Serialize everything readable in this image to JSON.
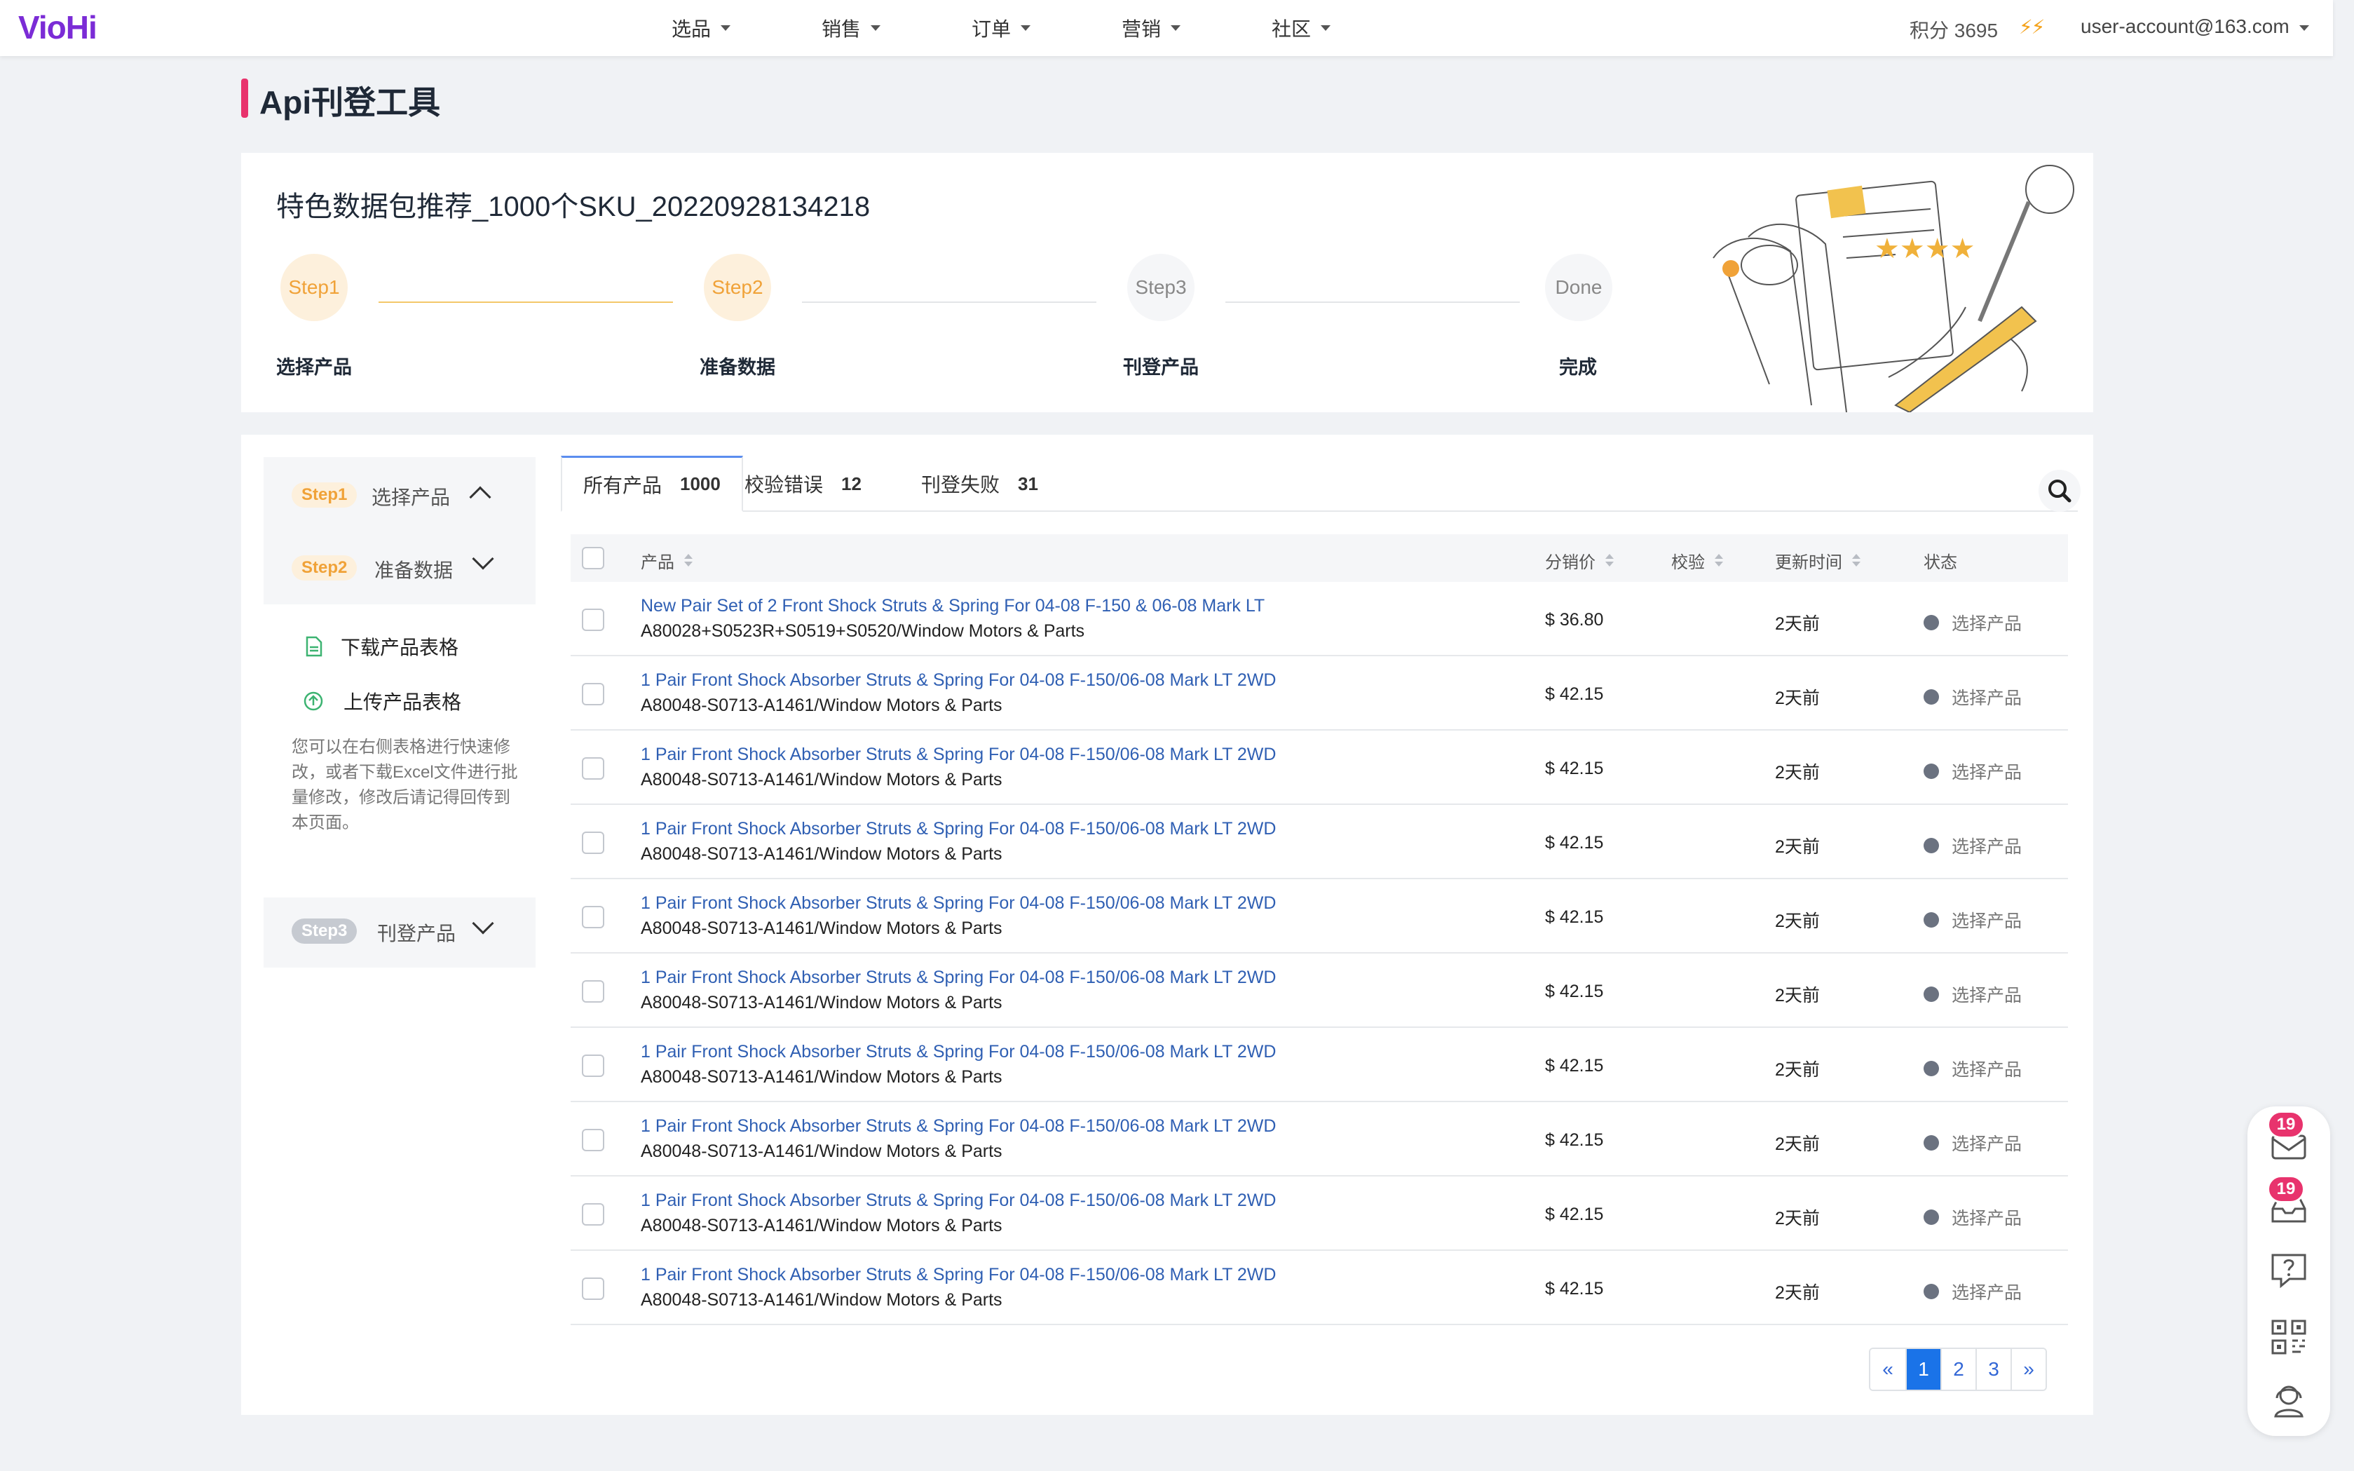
{
  "app": {
    "logo": "VioHi",
    "nav": [
      "选品",
      "销售",
      "订单",
      "营销",
      "社区"
    ],
    "points_label": "积分 3695",
    "bolts": "⚡⚡",
    "account": "user-account@163.com"
  },
  "page": {
    "title": "Api刊登工具"
  },
  "header": {
    "pack_title": "特色数据包推荐_1000个SKU_20220928134218",
    "steps": [
      {
        "circle": "Step1",
        "label": "选择产品"
      },
      {
        "circle": "Step2",
        "label": "准备数据"
      },
      {
        "circle": "Step3",
        "label": "刊登产品"
      },
      {
        "circle": "Done",
        "label": "完成"
      }
    ]
  },
  "left_panel": {
    "step1": {
      "tag": "Step1",
      "label": "选择产品"
    },
    "step2": {
      "tag": "Step2",
      "label": "准备数据"
    },
    "download": "下载产品表格",
    "upload": "上传产品表格",
    "note": "您可以在右侧表格进行快速修改，或者下载Excel文件进行批量修改，修改后请记得回传到本页面。",
    "step3": {
      "tag": "Step3",
      "label": "刊登产品"
    }
  },
  "tabs": [
    {
      "label": "所有产品",
      "count": "1000"
    },
    {
      "label": "校验错误",
      "count": "12"
    },
    {
      "label": "刊登失败",
      "count": "31"
    }
  ],
  "table": {
    "columns": {
      "product": "产品",
      "price": "分销价",
      "check": "校验",
      "updated": "更新时间",
      "status": "状态"
    },
    "rows": [
      {
        "name": "New Pair Set of 2 Front Shock Struts & Spring For 04-08 F-150 & 06-08 Mark LT",
        "sku": "A80028+S0523R+S0519+S0520/Window Motors & Parts",
        "price": "$ 36.80",
        "updated": "2天前",
        "status": "选择产品"
      },
      {
        "name": "1 Pair Front Shock Absorber Struts & Spring For 04-08 F-150/06-08 Mark LT 2WD",
        "sku": "A80048-S0713-A1461/Window Motors & Parts",
        "price": "$ 42.15",
        "updated": "2天前",
        "status": "选择产品"
      },
      {
        "name": "1 Pair Front Shock Absorber Struts & Spring For 04-08 F-150/06-08 Mark LT 2WD",
        "sku": "A80048-S0713-A1461/Window Motors & Parts",
        "price": "$ 42.15",
        "updated": "2天前",
        "status": "选择产品"
      },
      {
        "name": "1 Pair Front Shock Absorber Struts & Spring For 04-08 F-150/06-08 Mark LT 2WD",
        "sku": "A80048-S0713-A1461/Window Motors & Parts",
        "price": "$ 42.15",
        "updated": "2天前",
        "status": "选择产品"
      },
      {
        "name": "1 Pair Front Shock Absorber Struts & Spring For 04-08 F-150/06-08 Mark LT 2WD",
        "sku": "A80048-S0713-A1461/Window Motors & Parts",
        "price": "$ 42.15",
        "updated": "2天前",
        "status": "选择产品"
      },
      {
        "name": "1 Pair Front Shock Absorber Struts & Spring For 04-08 F-150/06-08 Mark LT 2WD",
        "sku": "A80048-S0713-A1461/Window Motors & Parts",
        "price": "$ 42.15",
        "updated": "2天前",
        "status": "选择产品"
      },
      {
        "name": "1 Pair Front Shock Absorber Struts & Spring For 04-08 F-150/06-08 Mark LT 2WD",
        "sku": "A80048-S0713-A1461/Window Motors & Parts",
        "price": "$ 42.15",
        "updated": "2天前",
        "status": "选择产品"
      },
      {
        "name": "1 Pair Front Shock Absorber Struts & Spring For 04-08 F-150/06-08 Mark LT 2WD",
        "sku": "A80048-S0713-A1461/Window Motors & Parts",
        "price": "$ 42.15",
        "updated": "2天前",
        "status": "选择产品"
      },
      {
        "name": "1 Pair Front Shock Absorber Struts & Spring For 04-08 F-150/06-08 Mark LT 2WD",
        "sku": "A80048-S0713-A1461/Window Motors & Parts",
        "price": "$ 42.15",
        "updated": "2天前",
        "status": "选择产品"
      },
      {
        "name": "1 Pair Front Shock Absorber Struts & Spring For 04-08 F-150/06-08 Mark LT 2WD",
        "sku": "A80048-S0713-A1461/Window Motors & Parts",
        "price": "$ 42.15",
        "updated": "2天前",
        "status": "选择产品"
      }
    ]
  },
  "pagination": {
    "prev": "«",
    "pages": [
      "1",
      "2",
      "3"
    ],
    "next": "»"
  },
  "float": {
    "mail_badge": "19",
    "inbox_badge": "19"
  },
  "colors": {
    "brand": "#7b2cd6",
    "accent": "#e8336d",
    "step_active": "#f0a238",
    "link": "#2f5fb3",
    "page_active": "#1a73e8"
  }
}
